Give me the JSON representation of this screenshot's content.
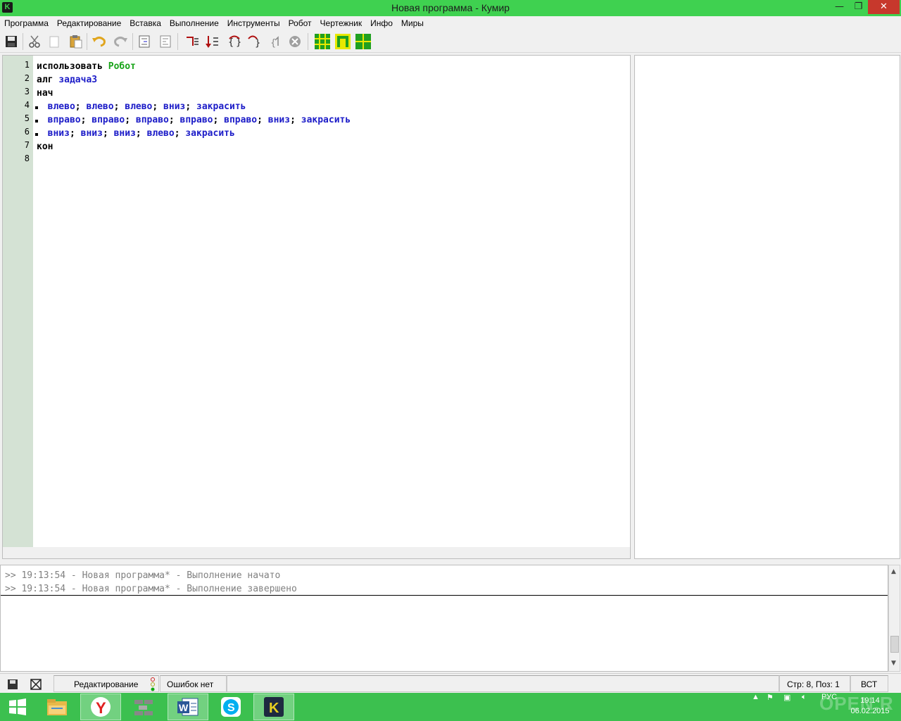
{
  "window": {
    "title": "Новая программа - Кумир",
    "icon_letter": "K",
    "min_glyph": "—",
    "max_glyph": "❐",
    "close_glyph": "✕"
  },
  "menu": [
    "Программа",
    "Редактирование",
    "Вставка",
    "Выполнение",
    "Инструменты",
    "Робот",
    "Чертежник",
    "Инфо",
    "Миры"
  ],
  "toolbar": {
    "icons": [
      "save-icon",
      "cut-icon",
      "copy-icon",
      "paste-icon",
      "undo-icon",
      "redo-icon",
      "indent-icon",
      "unindent-icon",
      "run-continuous-icon",
      "run-step-icon",
      "step-into-icon",
      "step-out-icon",
      "step-over-icon",
      "stop-icon",
      "robot-field-icon",
      "robot-icon",
      "drawer-icon"
    ]
  },
  "editor": {
    "line_numbers": [
      "1",
      "2",
      "3",
      "4",
      "5",
      "6",
      "7",
      "8"
    ],
    "lines": [
      {
        "parts": [
          {
            "t": "использовать ",
            "c": "black"
          },
          {
            "t": "Робот",
            "c": "green"
          }
        ]
      },
      {
        "parts": [
          {
            "t": "алг ",
            "c": "black"
          },
          {
            "t": "задача3",
            "c": "blue"
          }
        ]
      },
      {
        "parts": [
          {
            "t": "нач",
            "c": "black"
          }
        ]
      },
      {
        "parts": [
          {
            "t": "  влево",
            "c": "blue"
          },
          {
            "t": "; ",
            "c": "black"
          },
          {
            "t": "влево",
            "c": "blue"
          },
          {
            "t": "; ",
            "c": "black"
          },
          {
            "t": "влево",
            "c": "blue"
          },
          {
            "t": "; ",
            "c": "black"
          },
          {
            "t": "вниз",
            "c": "blue"
          },
          {
            "t": "; ",
            "c": "black"
          },
          {
            "t": "закрасить",
            "c": "blue"
          }
        ],
        "dot": true
      },
      {
        "parts": [
          {
            "t": "  вправо",
            "c": "blue"
          },
          {
            "t": "; ",
            "c": "black"
          },
          {
            "t": "вправо",
            "c": "blue"
          },
          {
            "t": "; ",
            "c": "black"
          },
          {
            "t": "вправо",
            "c": "blue"
          },
          {
            "t": "; ",
            "c": "black"
          },
          {
            "t": "вправо",
            "c": "blue"
          },
          {
            "t": "; ",
            "c": "black"
          },
          {
            "t": "вправо",
            "c": "blue"
          },
          {
            "t": "; ",
            "c": "black"
          },
          {
            "t": "вниз",
            "c": "blue"
          },
          {
            "t": "; ",
            "c": "black"
          },
          {
            "t": "закрасить",
            "c": "blue"
          }
        ],
        "dot": true
      },
      {
        "parts": [
          {
            "t": "  вниз",
            "c": "blue"
          },
          {
            "t": "; ",
            "c": "black"
          },
          {
            "t": "вниз",
            "c": "blue"
          },
          {
            "t": "; ",
            "c": "black"
          },
          {
            "t": "вниз",
            "c": "blue"
          },
          {
            "t": "; ",
            "c": "black"
          },
          {
            "t": "влево",
            "c": "blue"
          },
          {
            "t": "; ",
            "c": "black"
          },
          {
            "t": "закрасить",
            "c": "blue"
          }
        ],
        "dot": true
      },
      {
        "parts": [
          {
            "t": "кон",
            "c": "black"
          }
        ]
      },
      {
        "parts": []
      }
    ]
  },
  "console": {
    "messages": [
      ">> 19:13:54 - Новая программа* - Выполнение начато",
      ">> 19:13:54 - Новая программа* - Выполнение завершено"
    ]
  },
  "statusbar": {
    "mode": "Редактирование",
    "errors": "Ошибок нет",
    "position": "Стр: 8, Поз: 1",
    "insert_mode": "ВСТ"
  },
  "taskbar": {
    "apps": [
      "file-explorer-icon",
      "yandex-browser-icon",
      "app-icon",
      "word-icon",
      "skype-icon",
      "kumir-icon"
    ],
    "language": "РУС",
    "time": "19:14",
    "date": "06.02.2015",
    "watermark": "OPEN.R"
  },
  "colors": {
    "titlebar": "#3fd150",
    "taskbar": "#3cc04f",
    "gutter": "#d4e2d4",
    "keyword_blue": "#1c1cc8",
    "keyword_green": "#18a418"
  }
}
